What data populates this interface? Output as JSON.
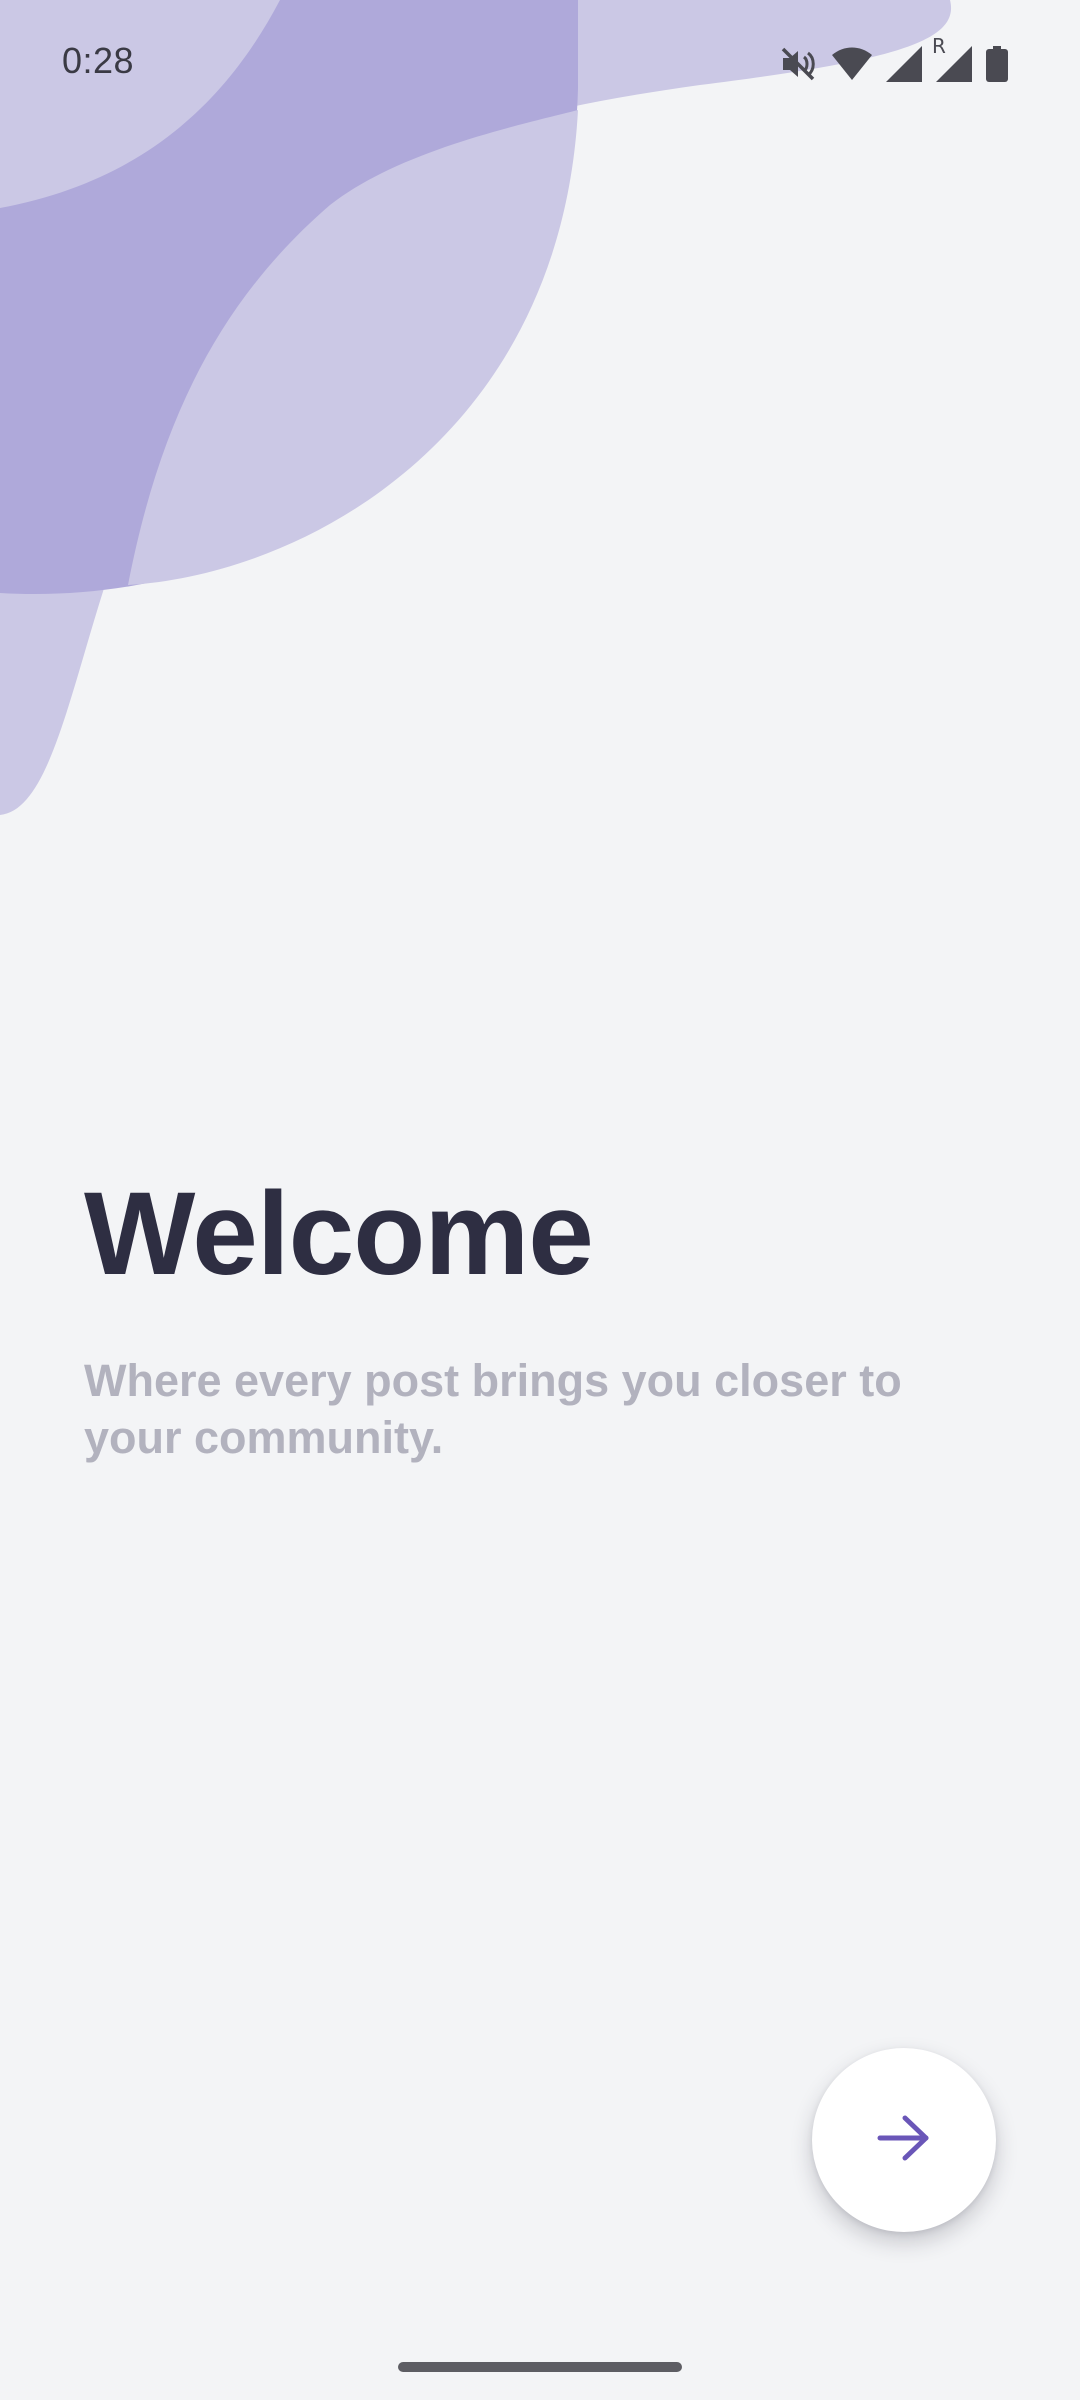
{
  "status_bar": {
    "time": "0:28",
    "roaming_indicator": "R",
    "icons": [
      "mute-icon",
      "wifi-icon",
      "signal-icon",
      "roaming-signal-icon",
      "battery-icon"
    ]
  },
  "welcome": {
    "title": "Welcome",
    "subtitle": "Where every post brings you closer to your community."
  },
  "next_button": {
    "icon": "arrow-right-icon"
  },
  "colors": {
    "background": "#f3f4f6",
    "blob_light": "#cbc8e5",
    "blob_dark": "#afa9da",
    "title": "#2e2e42",
    "subtitle": "#b2b2be",
    "accent": "#6a56b8"
  }
}
